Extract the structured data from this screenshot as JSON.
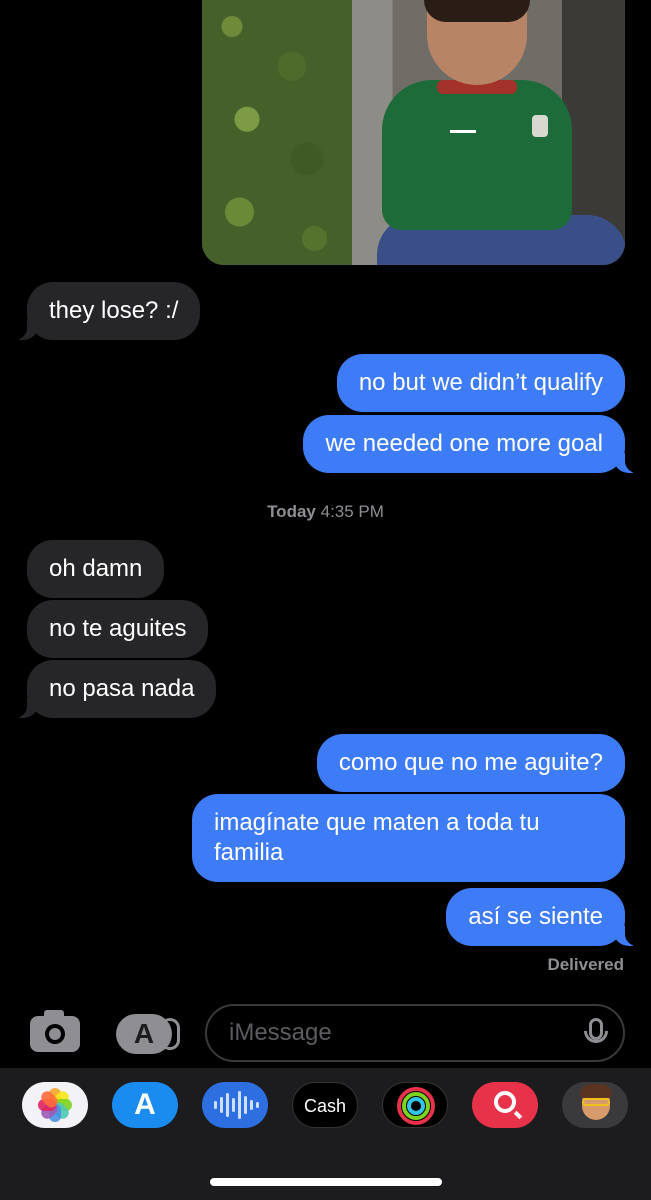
{
  "conversation": {
    "messages": [
      {
        "id": "m1",
        "direction": "incoming",
        "text": "they lose? :/"
      },
      {
        "id": "m2",
        "direction": "outgoing",
        "text": "no but we didn’t qualify"
      },
      {
        "id": "m3",
        "direction": "outgoing",
        "text": "we needed one more goal"
      },
      {
        "id": "m4",
        "direction": "incoming",
        "text": "oh damn"
      },
      {
        "id": "m5",
        "direction": "incoming",
        "text": "no te aguites"
      },
      {
        "id": "m6",
        "direction": "incoming",
        "text": "no pasa nada"
      },
      {
        "id": "m7",
        "direction": "outgoing",
        "text": "como que no me aguite?"
      },
      {
        "id": "m8a",
        "direction": "outgoing",
        "text": "imagínate que maten a toda tu"
      },
      {
        "id": "m8b",
        "direction": "outgoing",
        "text": "familia"
      },
      {
        "id": "m9",
        "direction": "outgoing",
        "text": "así se siente"
      }
    ],
    "timestamp": {
      "day": "Today",
      "time": "4:35 PM"
    },
    "status": "Delivered"
  },
  "composer": {
    "placeholder": "iMessage",
    "camera_icon": "camera-icon",
    "apps_icon": "app-store-icon",
    "mic_icon": "microphone-icon"
  },
  "app_tray": [
    {
      "name": "photos-app-icon"
    },
    {
      "name": "app-store-app-icon",
      "glyph": "A"
    },
    {
      "name": "audio-message-app-icon"
    },
    {
      "name": "apple-cash-app-icon",
      "label": "Cash"
    },
    {
      "name": "activity-app-icon"
    },
    {
      "name": "image-search-app-icon"
    },
    {
      "name": "memoji-app-icon"
    }
  ],
  "colors": {
    "outgoing": "#3d7bf7",
    "incoming": "#262629",
    "background": "#000000"
  }
}
